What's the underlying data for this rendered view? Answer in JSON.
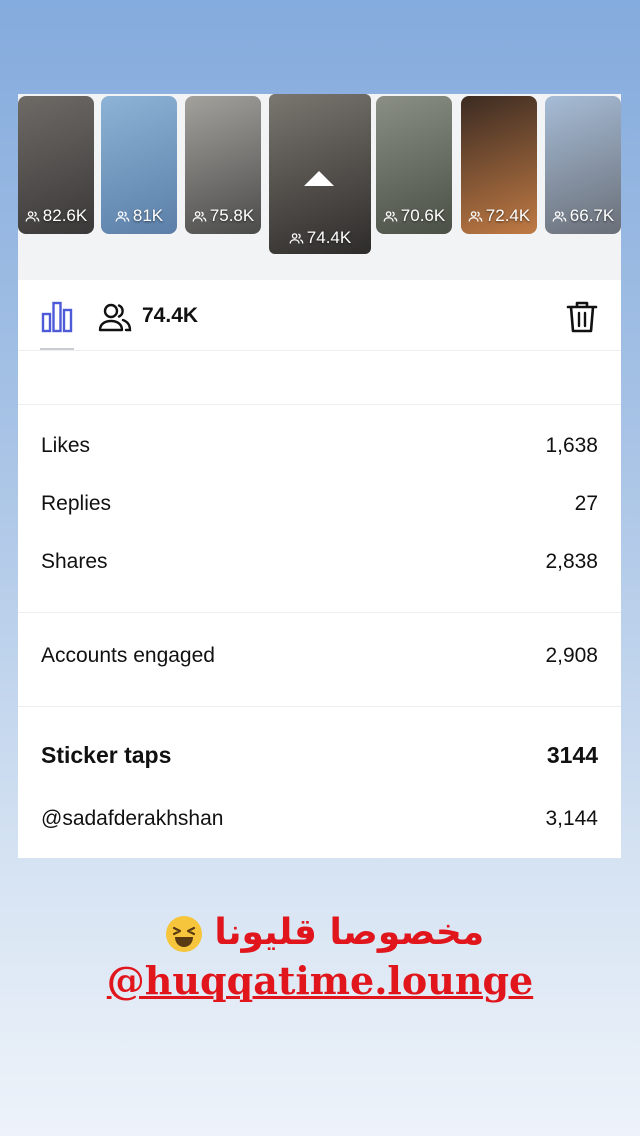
{
  "stories": [
    {
      "views": "82.6K",
      "colors": [
        "#6e6a66",
        "#3a3838"
      ]
    },
    {
      "views": "81K",
      "colors": [
        "#8db3d6",
        "#5b7fa8"
      ]
    },
    {
      "views": "75.8K",
      "colors": [
        "#a3a19c",
        "#4b4b4a"
      ]
    },
    {
      "views": "74.4K",
      "colors": [
        "#7a7670",
        "#2e2c2a"
      ],
      "selected": true
    },
    {
      "views": "70.6K",
      "colors": [
        "#8a8f86",
        "#4a5046"
      ]
    },
    {
      "views": "72.4K",
      "colors": [
        "#3b2b22",
        "#c07a44"
      ]
    },
    {
      "views": "66.7K",
      "colors": [
        "#a6bcd6",
        "#6a6f78"
      ]
    }
  ],
  "summary": {
    "reach": "74.4K"
  },
  "metrics": {
    "likes": {
      "label": "Likes",
      "value": "1,638"
    },
    "replies": {
      "label": "Replies",
      "value": "27"
    },
    "shares": {
      "label": "Shares",
      "value": "2,838"
    },
    "accounts_engaged": {
      "label": "Accounts engaged",
      "value": "2,908"
    },
    "sticker_taps": {
      "label": "Sticker taps",
      "value": "3144"
    },
    "mention": {
      "label": "@sadafderakhshan",
      "value": "3,144"
    }
  },
  "caption": {
    "arabic": "مخصوصا قليونا",
    "handle": "@huqqatime.lounge"
  },
  "colors": {
    "accent": "#4e5bd8",
    "caption": "#e0161c"
  }
}
